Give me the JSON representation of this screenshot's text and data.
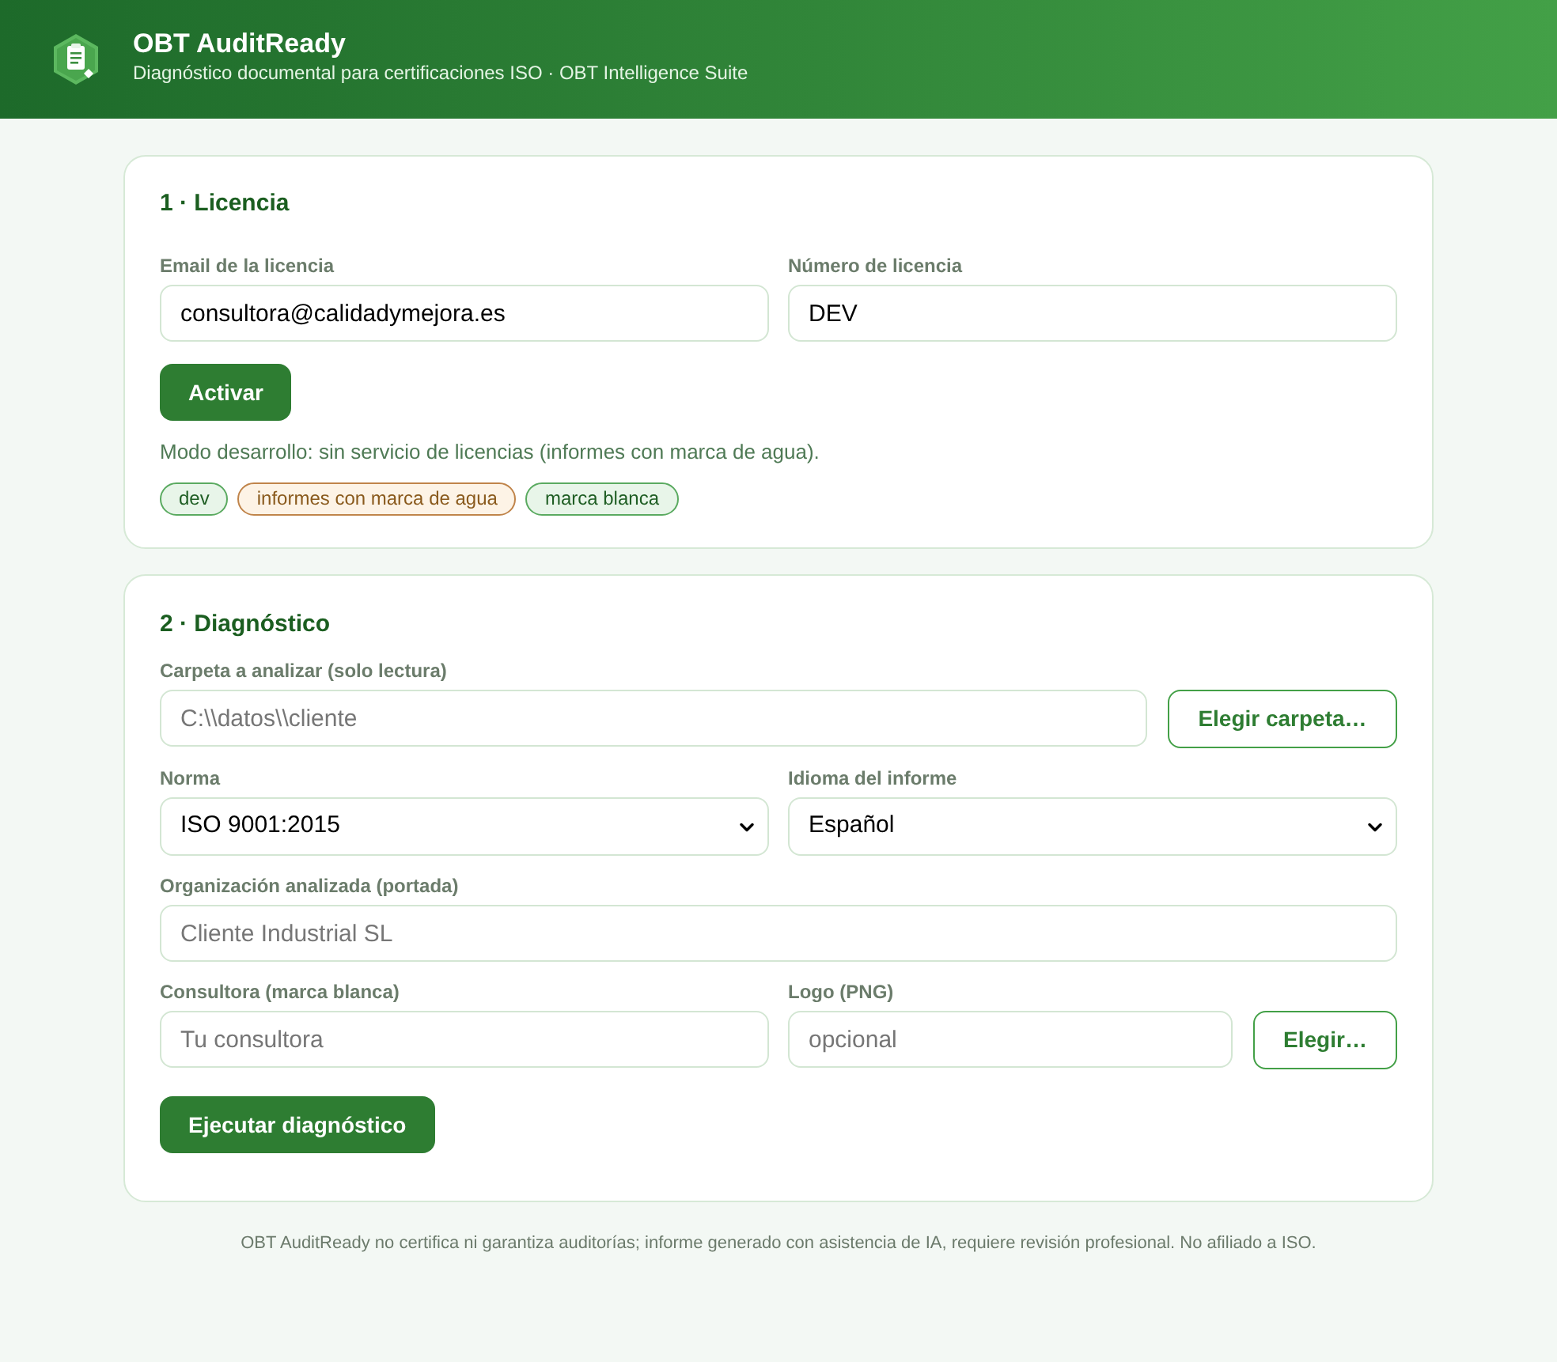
{
  "header": {
    "title": "OBT AuditReady",
    "subtitle": "Diagnóstico documental para certificaciones ISO · OBT Intelligence Suite"
  },
  "license_card": {
    "title": "1 · Licencia",
    "fields": [
      {
        "label": "Email de la licencia",
        "value": "consultora@calidadymejora.es"
      },
      {
        "label": "Número de licencia",
        "value": "DEV"
      }
    ],
    "button": "Activar",
    "status_text": "Modo desarrollo: sin servicio de licencias (informes con marca de agua).",
    "tags": [
      {
        "label": "dev",
        "kind": "success"
      },
      {
        "label": "informes con marca de agua",
        "kind": "warning"
      },
      {
        "label": "marca blanca",
        "kind": "success"
      }
    ]
  },
  "diagnosis_card": {
    "title": "2 · Diagnóstico",
    "folder": {
      "label": "Carpeta a analizar (solo lectura)",
      "placeholder": "C:\\\\datos\\\\cliente",
      "button": "Elegir carpeta…"
    },
    "selects": [
      {
        "label": "Norma",
        "value": "ISO 9001:2015"
      },
      {
        "label": "Idioma del informe",
        "value": "Español"
      }
    ],
    "organization": {
      "label": "Organización analizada (portada)",
      "placeholder": "Cliente Industrial SL"
    },
    "consultancy": {
      "label": "Consultora (marca blanca)",
      "placeholder": "Tu consultora"
    },
    "logo": {
      "label": "Logo (PNG)",
      "placeholder": "opcional",
      "button": "Elegir…"
    },
    "run_button": "Ejecutar diagnóstico"
  },
  "footer": {
    "disclaimer": "OBT AuditReady no certifica ni garantiza auditorías; informe generado con asistencia de IA, requiere revisión profesional. No afiliado a ISO."
  }
}
